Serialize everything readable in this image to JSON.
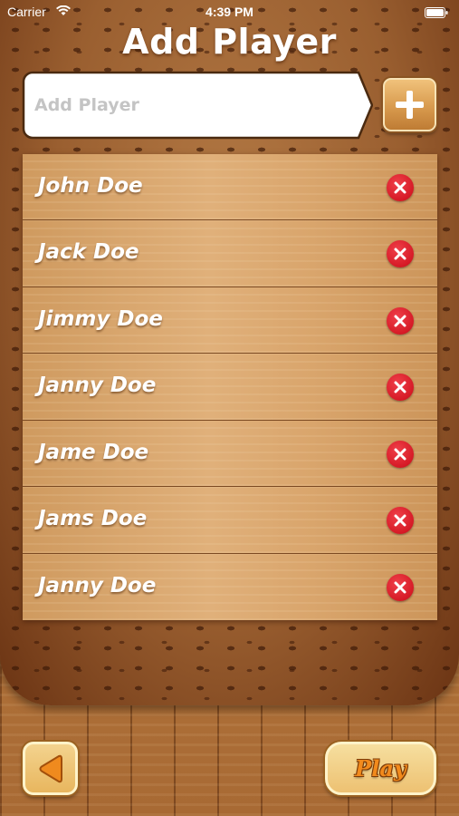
{
  "status_bar": {
    "carrier": "Carrier",
    "time": "4:39 PM"
  },
  "header": {
    "title": "Add Player"
  },
  "add_form": {
    "placeholder": "Add Player",
    "value": "",
    "add_icon": "plus-icon"
  },
  "players": [
    {
      "name": "John Doe",
      "remove_icon": "close-icon"
    },
    {
      "name": "Jack Doe",
      "remove_icon": "close-icon"
    },
    {
      "name": "Jimmy Doe",
      "remove_icon": "close-icon"
    },
    {
      "name": "Janny Doe",
      "remove_icon": "close-icon"
    },
    {
      "name": "Jame Doe",
      "remove_icon": "close-icon"
    },
    {
      "name": "Jams Doe",
      "remove_icon": "close-icon"
    },
    {
      "name": "Janny Doe",
      "remove_icon": "close-icon"
    }
  ],
  "footer": {
    "back_icon": "back-arrow-icon",
    "play_label": "Play"
  },
  "colors": {
    "panel": "#9a5f30",
    "row_wood": "#e0b07a",
    "remove_red": "#d61a26",
    "play_text": "#f28a1c"
  }
}
